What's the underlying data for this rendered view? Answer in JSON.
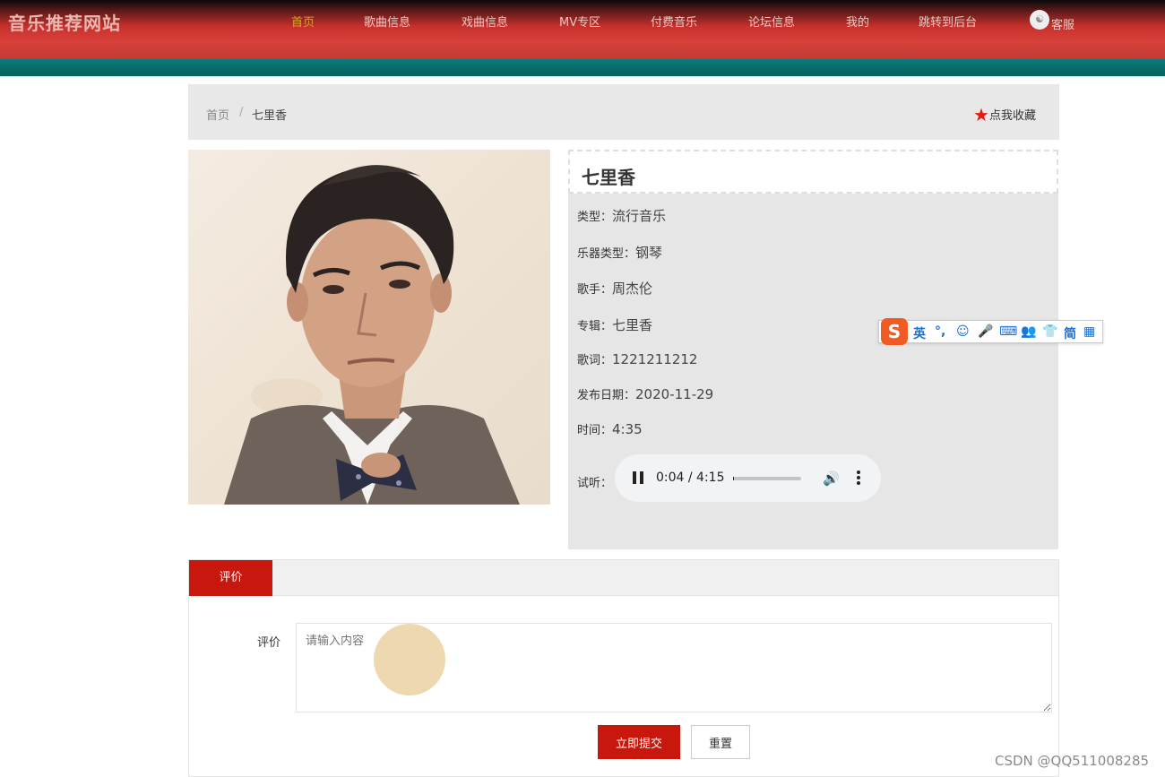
{
  "header": {
    "site_title": "音乐推荐网站",
    "nav": [
      "首页",
      "歌曲信息",
      "戏曲信息",
      "MV专区",
      "付费音乐",
      "论坛信息",
      "我的",
      "跳转到后台"
    ],
    "active_index": 0,
    "service_label": "客服",
    "colors": {
      "header_red": "#c9302c",
      "teal_band": "#0b7a78",
      "active_nav": "#d7a32c"
    }
  },
  "breadcrumb": {
    "home": "首页",
    "separator": "/",
    "current": "七里香"
  },
  "favorite": {
    "star": "★",
    "label": "点我收藏"
  },
  "song": {
    "title": "七里香",
    "fields": [
      {
        "label": "类型：",
        "value": "流行音乐"
      },
      {
        "label": "乐器类型：",
        "value": "钢琴"
      },
      {
        "label": "歌手：",
        "value": "周杰伦"
      },
      {
        "label": "专辑：",
        "value": "七里香"
      },
      {
        "label": "歌词：",
        "value": "1221211212"
      },
      {
        "label": "发布日期：",
        "value": "2020-11-29"
      },
      {
        "label": "时间：",
        "value": "4:35"
      }
    ],
    "preview_label": "试听："
  },
  "player": {
    "time": "0:04 / 4:15",
    "progress": 0.016,
    "state": "playing"
  },
  "ime_toolbar": {
    "logo": "S",
    "items": [
      "英",
      "°,",
      "☺",
      "🎤",
      "⌨",
      "👥",
      "👕",
      "简",
      "▦"
    ]
  },
  "comment": {
    "tab_label": "评价",
    "field_label": "评价",
    "placeholder": "请输入内容",
    "submit_label": "立即提交",
    "reset_label": "重置"
  },
  "watermark": "CSDN @QQ511008285",
  "colors": {
    "accent_red": "#c8170c",
    "star_red": "#e31b12"
  }
}
